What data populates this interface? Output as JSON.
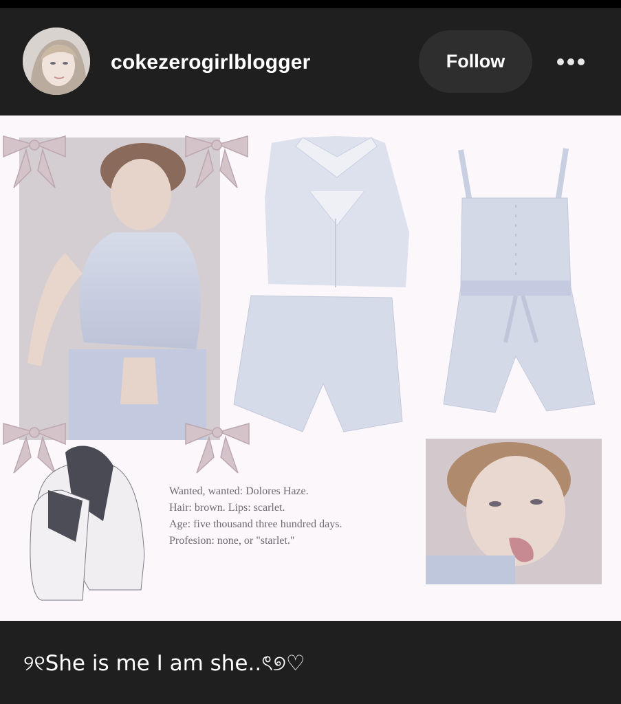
{
  "header": {
    "username": "cokezerogirlblogger",
    "follow_label": "Follow"
  },
  "post": {
    "poem_lines": [
      "Wanted, wanted: Dolores Haze.",
      "Hair: brown. Lips: scarlet.",
      "Age: five thousand three hundred days.",
      "Profesion: none, or \"starlet.\""
    ]
  },
  "caption": {
    "text": "୨୧She is me I am she..ৎ୭♡"
  },
  "icons": {
    "more": "more-horizontal-icon",
    "avatar": "profile-photo"
  }
}
